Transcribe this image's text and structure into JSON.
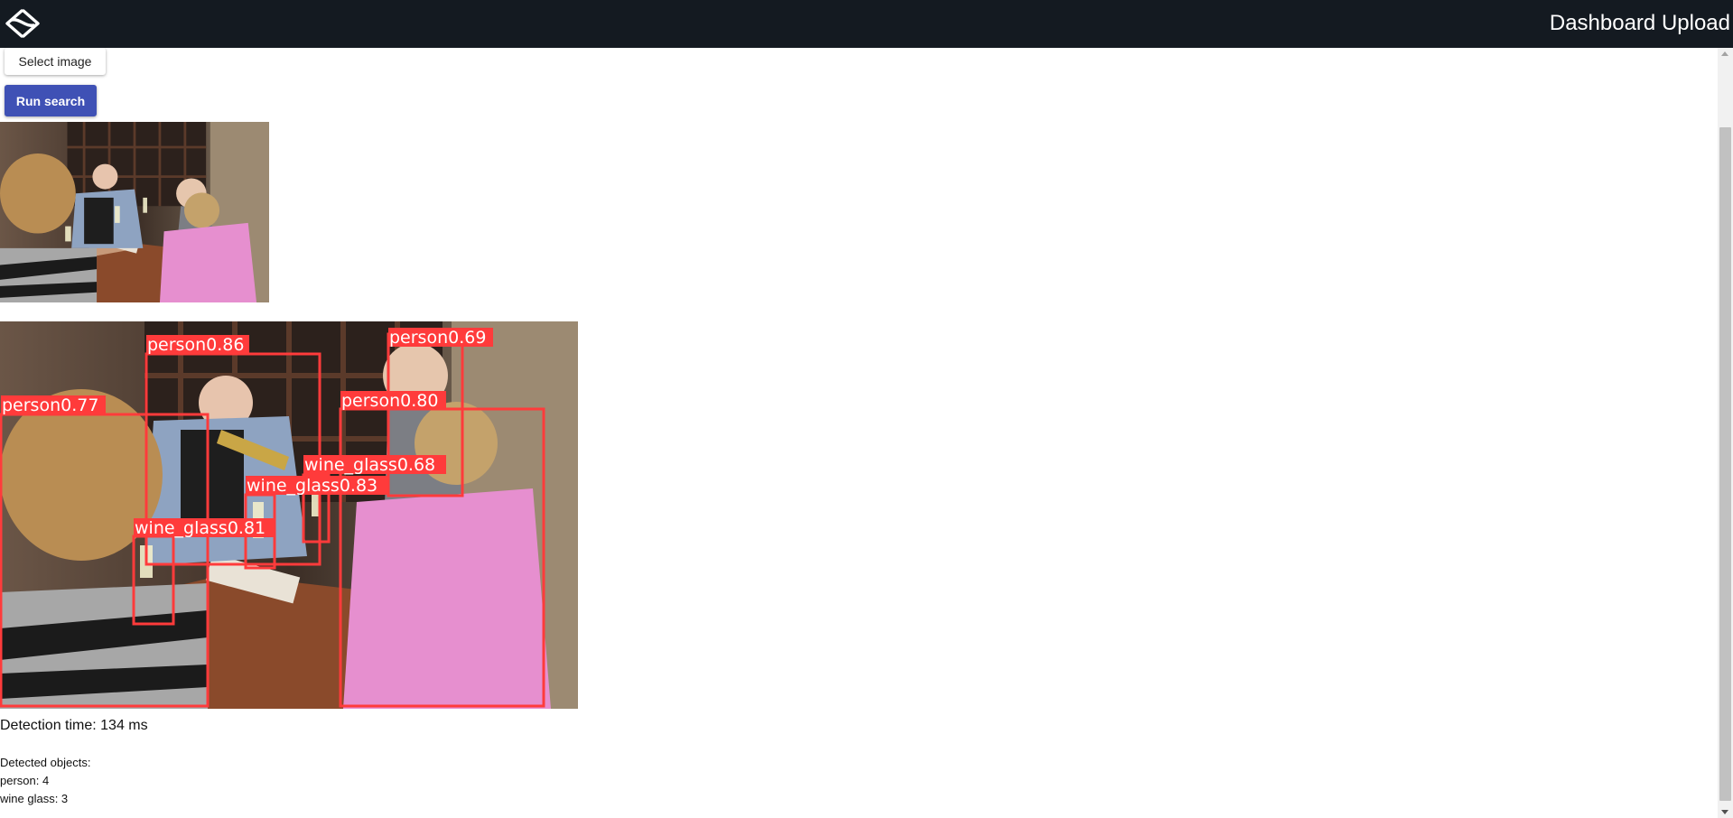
{
  "header": {
    "logo_icon": "swirl-logo-icon",
    "title": "Dashboard Upload"
  },
  "controls": {
    "select_label": "Select image",
    "run_label": "Run search",
    "accent": "#3f51b5"
  },
  "detections": [
    {
      "label": "person0.86"
    },
    {
      "label": "person0.69"
    },
    {
      "label": "person0.77"
    },
    {
      "label": "person0.80"
    },
    {
      "label": "wine_glass0.68"
    },
    {
      "label": "wine_glass0.83"
    },
    {
      "label": "wine_glass0.81"
    }
  ],
  "box_color": "#ff3b3b",
  "results": {
    "detection_time": "Detection time: 134 ms",
    "heading": "Detected objects:",
    "counts": [
      "person: 4",
      "wine glass: 3"
    ]
  }
}
